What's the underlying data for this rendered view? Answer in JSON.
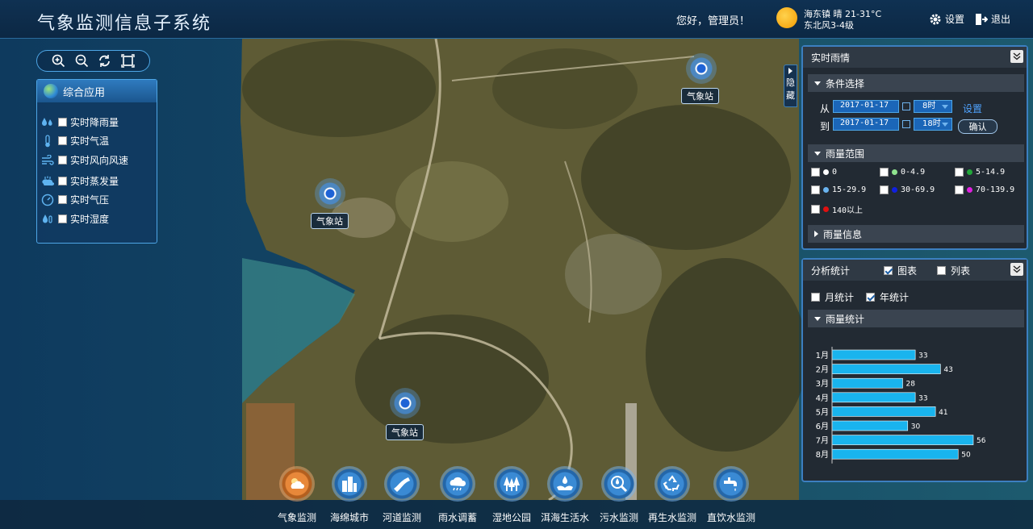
{
  "header": {
    "title": "气象监测信息子系统",
    "greeting": "您好，管理员！",
    "weather_location": "海东镇  晴  21-31°C",
    "weather_wind": "东北风3-4级",
    "settings_label": "设置",
    "logout_label": "退出"
  },
  "left_panel": {
    "title": "综合应用",
    "layers": [
      {
        "label": "实时降雨量",
        "icon": "rain-drops-icon",
        "checked": false
      },
      {
        "label": "实时气温",
        "icon": "thermometer-icon",
        "checked": false
      },
      {
        "label": "实时风向风速",
        "icon": "wind-icon",
        "checked": false
      },
      {
        "label": "实时蒸发量",
        "icon": "evaporation-icon",
        "checked": false
      },
      {
        "label": "实时气压",
        "icon": "pressure-gauge-icon",
        "checked": false
      },
      {
        "label": "实时湿度",
        "icon": "humidity-icon",
        "checked": false
      }
    ]
  },
  "stations": [
    {
      "label": "气象站"
    },
    {
      "label": "气象站"
    },
    {
      "label": "气象站"
    }
  ],
  "hide_tab": {
    "label_1": "隐",
    "label_2": "藏"
  },
  "rain_panel": {
    "title": "实时雨情",
    "condition_section": "条件选择",
    "from_label": "从",
    "to_label": "到",
    "from_date": "2017-01-17",
    "from_hour": "8时",
    "to_date": "2017-01-17",
    "to_hour": "18时",
    "set_label": "设置",
    "confirm_label": "确认",
    "range_section": "雨量范围",
    "ranges": [
      {
        "label": "0",
        "color": "#ffffff"
      },
      {
        "label": "0-4.9",
        "color": "#8fe38f"
      },
      {
        "label": "5-14.9",
        "color": "#22a83a"
      },
      {
        "label": "15-29.9",
        "color": "#6ab4f0"
      },
      {
        "label": "30-69.9",
        "color": "#1020e0"
      },
      {
        "label": "70-139.9",
        "color": "#e020e0"
      },
      {
        "label": "140以上",
        "color": "#e01010"
      }
    ],
    "info_section": "雨量信息"
  },
  "stats_panel": {
    "title": "分析统计",
    "chart_option": "图表",
    "chart_option_checked": true,
    "list_option": "列表",
    "list_option_checked": false,
    "monthly_label": "月统计",
    "monthly_checked": false,
    "yearly_label": "年统计",
    "yearly_checked": true,
    "rain_stat_section": "雨量统计"
  },
  "chart_data": {
    "type": "bar",
    "orientation": "horizontal",
    "categories": [
      "1月",
      "2月",
      "3月",
      "4月",
      "5月",
      "6月",
      "7月",
      "8月"
    ],
    "values": [
      33,
      43,
      28,
      33,
      41,
      30,
      56,
      50
    ],
    "bar_color": "#19b4ee",
    "title": "",
    "xlabel": "",
    "ylabel": ""
  },
  "bottom_nav": [
    {
      "label": "气象监测",
      "icon": "weather-cloud-icon",
      "active": true
    },
    {
      "label": "海绵城市",
      "icon": "city-buildings-icon",
      "active": false
    },
    {
      "label": "河道监测",
      "icon": "river-icon",
      "active": false
    },
    {
      "label": "雨水调蓄",
      "icon": "rain-cloud-icon",
      "active": false
    },
    {
      "label": "湿地公园",
      "icon": "trees-icon",
      "active": false
    },
    {
      "label": "洱海生活水",
      "icon": "water-hand-icon",
      "active": false
    },
    {
      "label": "污水监测",
      "icon": "magnifier-drop-icon",
      "active": false
    },
    {
      "label": "再生水监测",
      "icon": "recycle-icon",
      "active": false
    },
    {
      "label": "直饮水监测",
      "icon": "faucet-icon",
      "active": false
    }
  ]
}
